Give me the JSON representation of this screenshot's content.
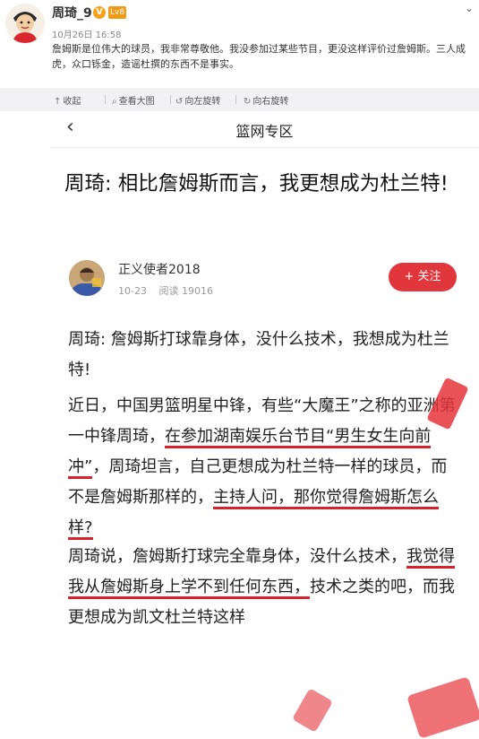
{
  "post": {
    "username": "周琦_9",
    "verified_badge": "V",
    "level_badge": "Lv8",
    "time": "10月26日 16:58",
    "text": "詹姆斯是位伟大的球员，我非常尊敬他。我没参加过某些节目，更没这样评价过詹姆斯。三人成虎，众口铄金，造谣杜撰的东西不是事实。",
    "menu_icon": "chevron-down-icon"
  },
  "toolbar": {
    "collapse": "收起",
    "view_large": "查看大图",
    "rotate_left": "向左旋转",
    "rotate_right": "向右旋转"
  },
  "article": {
    "nav_title": "篮网专区",
    "title": "周琦: 相比詹姆斯而言，我更想成为杜兰特!",
    "author": "正义使者2018",
    "date": "10-23",
    "reads": "阅读 19016",
    "follow": "+ 关注",
    "p1": "周琦: 詹姆斯打球靠身体，没什么技术，我想成为杜兰特!",
    "p2_a": "近日，中国男篮明星中锋，有些“大魔王”之称的亚洲第一中锋周琦，",
    "p2_b": "在参加湖南娱乐台节目“男生女生向前冲”",
    "p2_c": "，周琦坦言，自己更想成为杜兰特一样的球员，而不是詹姆斯那样的，",
    "p2_d": "主持人问，那你觉得詹姆斯怎么样?",
    "p3_a": "周琦说，詹姆斯打球完全靠身体，没什么技术，",
    "p3_b": "我觉得我从詹姆斯身上学不到任何东西，",
    "p3_c": "技术之类的吧，而我更想成为凯文杜兰特这样"
  },
  "colors": {
    "accent_red": "#e1363b",
    "underline_red": "#d6232b",
    "toolbar_bg": "#f2f2f5"
  }
}
